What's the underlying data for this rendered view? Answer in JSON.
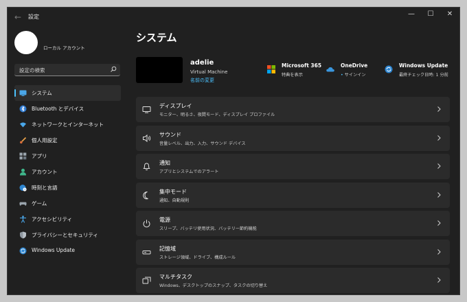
{
  "window": {
    "title": "設定"
  },
  "titlebar": {
    "minimize": "—",
    "maximize": "☐",
    "close": "✕",
    "back": "←"
  },
  "account": {
    "type": "ローカル アカウント"
  },
  "search": {
    "placeholder": "設定の検索"
  },
  "sidebar": {
    "items": [
      {
        "label": "システム",
        "icon": "system-icon",
        "active": true
      },
      {
        "label": "Bluetooth とデバイス",
        "icon": "bluetooth-icon"
      },
      {
        "label": "ネットワークとインターネット",
        "icon": "wifi-icon"
      },
      {
        "label": "個人用設定",
        "icon": "brush-icon"
      },
      {
        "label": "アプリ",
        "icon": "apps-icon"
      },
      {
        "label": "アカウント",
        "icon": "person-icon"
      },
      {
        "label": "時刻と言語",
        "icon": "globe-clock-icon"
      },
      {
        "label": "ゲーム",
        "icon": "gamepad-icon"
      },
      {
        "label": "アクセシビリティ",
        "icon": "accessibility-icon"
      },
      {
        "label": "プライバシーとセキュリティ",
        "icon": "shield-icon"
      },
      {
        "label": "Windows Update",
        "icon": "update-icon"
      }
    ]
  },
  "main": {
    "title": "システム",
    "device": {
      "name": "adelie",
      "model": "Virtual Machine",
      "rename": "名前の変更"
    },
    "quick": {
      "microsoft365": {
        "title": "Microsoft 365",
        "subtitle": "特典を表示"
      },
      "onedrive": {
        "title": "OneDrive",
        "subtitle_dot": "•",
        "subtitle": "サインイン"
      },
      "windows_update": {
        "title": "Windows Update",
        "subtitle": "最終チェック日時: 1 分前"
      }
    },
    "cards": [
      {
        "title": "ディスプレイ",
        "subtitle": "モニター、明るさ、夜間モード、ディスプレイ プロファイル",
        "icon": "display-icon"
      },
      {
        "title": "サウンド",
        "subtitle": "音量レベル、出力、入力、サウンド デバイス",
        "icon": "speaker-icon"
      },
      {
        "title": "通知",
        "subtitle": "アプリとシステムでのアラート",
        "icon": "bell-icon"
      },
      {
        "title": "集中モード",
        "subtitle": "通知、自動規則",
        "icon": "moon-icon"
      },
      {
        "title": "電源",
        "subtitle": "スリープ、バッテリ使用状況、バッテリー節約機能",
        "icon": "power-icon"
      },
      {
        "title": "記憶域",
        "subtitle": "ストレージ領域、ドライブ、構成ルール",
        "icon": "storage-icon"
      },
      {
        "title": "マルチタスク",
        "subtitle": "Windows、デスクトップのスナップ、タスクの切り替え",
        "icon": "multitask-icon"
      }
    ]
  },
  "colors": {
    "accent": "#4cc2ff",
    "background": "#202020",
    "card": "#2b2b2b"
  }
}
